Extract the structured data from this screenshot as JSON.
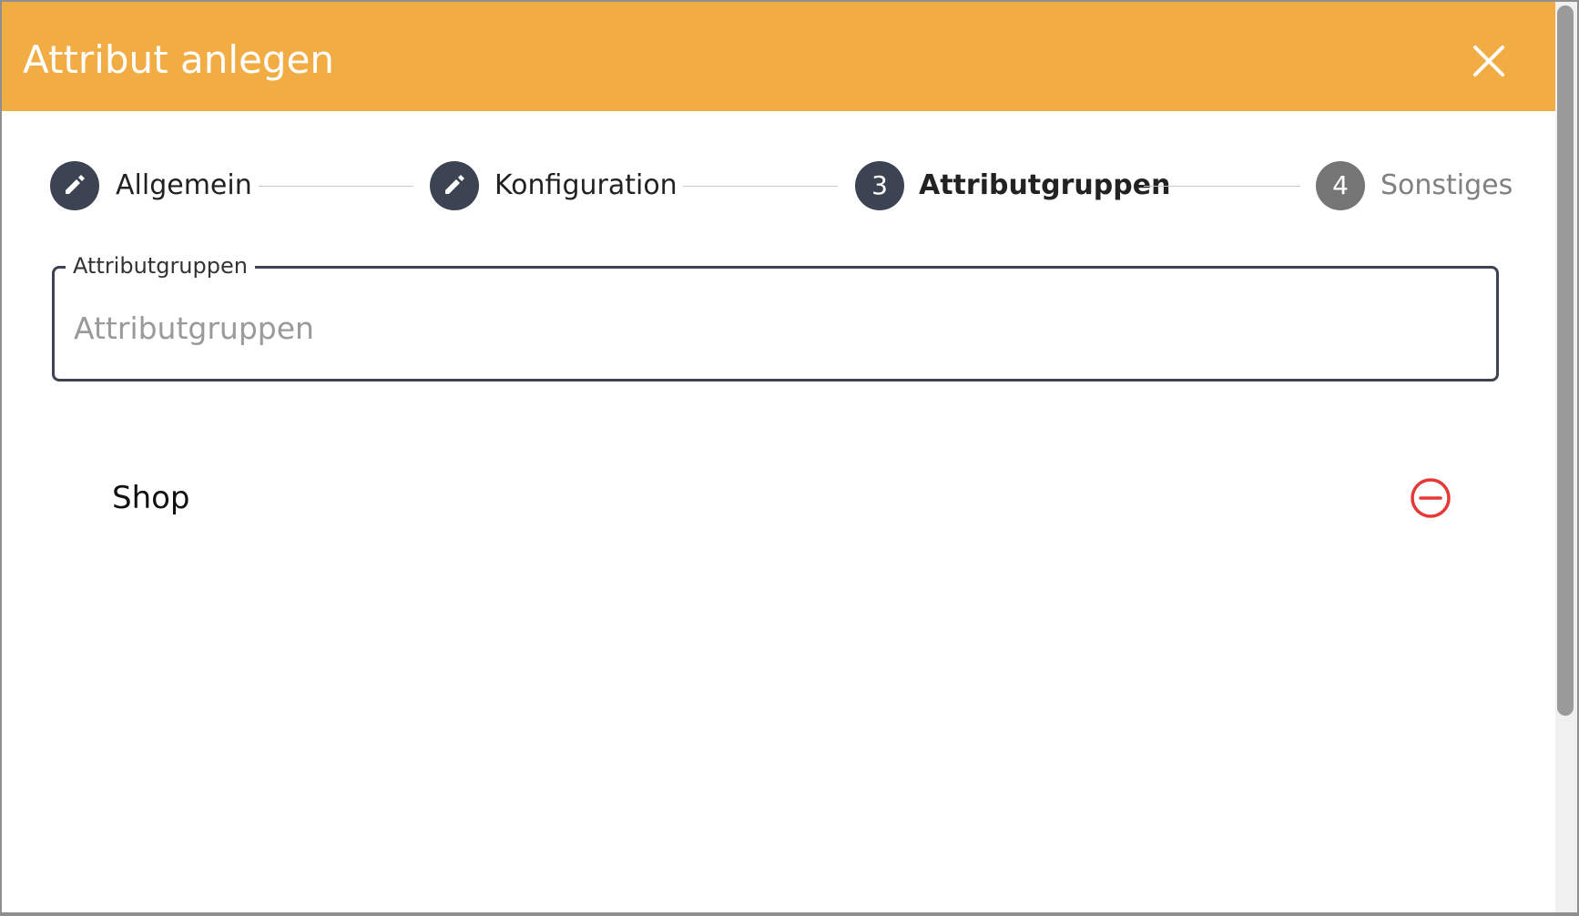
{
  "dialog": {
    "title": "Attribut anlegen",
    "close_icon": "close-icon",
    "header_color": "#f2ac44"
  },
  "stepper": {
    "steps": [
      {
        "label": "Allgemein",
        "state": "completed",
        "icon": "pencil-icon"
      },
      {
        "label": "Konfiguration",
        "state": "completed",
        "icon": "pencil-icon"
      },
      {
        "label": "Attributgruppen",
        "state": "active",
        "number": "3"
      },
      {
        "label": "Sonstiges",
        "state": "inactive",
        "number": "4"
      }
    ]
  },
  "attribute_groups": {
    "field_label": "Attributgruppen",
    "placeholder": "Attributgruppen",
    "value": "",
    "items": [
      {
        "label": "Shop",
        "action_icon": "minus-circle-icon",
        "action_color": "#e53935"
      }
    ]
  }
}
